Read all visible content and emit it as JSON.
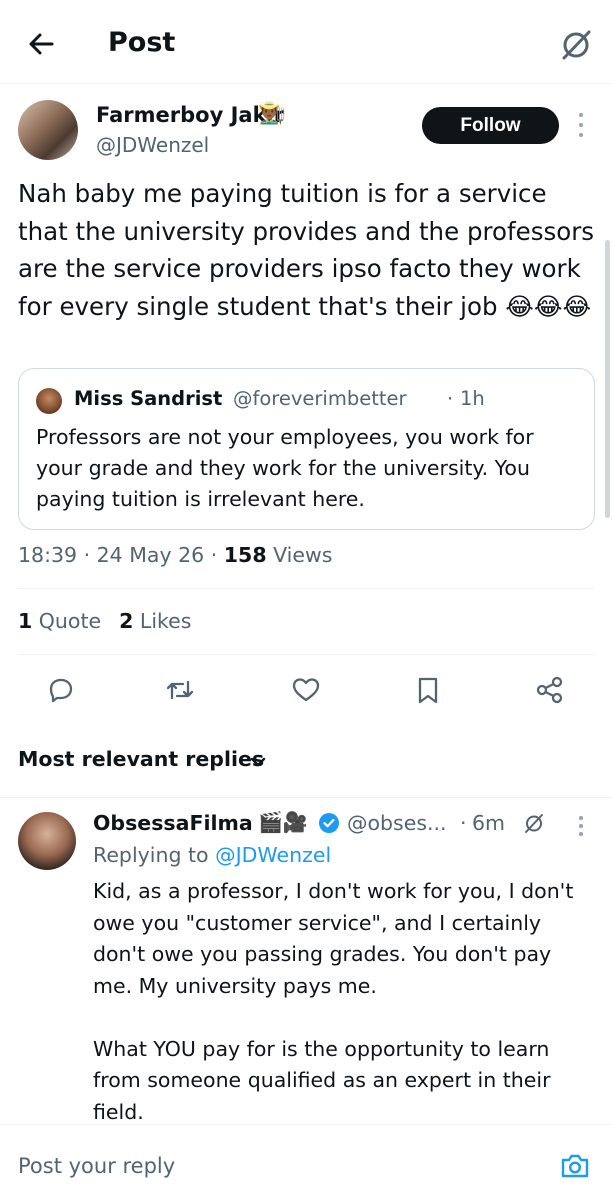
{
  "header": {
    "title": "Post",
    "back_icon": "arrow-left-icon",
    "grok_icon": "grok-slash-circle-icon"
  },
  "post": {
    "author": {
      "name": "Farmerboy Jakir",
      "emoji": "👨🏾‍🌾",
      "handle": "@JDWenzel"
    },
    "follow_label": "Follow",
    "text": "Nah baby me paying tuition is for a service that the university provides and the professors are the service providers ipso facto they work for every single student that's their job 😂😂😂",
    "quote": {
      "name": "Miss Sandrist",
      "handle": "@foreverimbetter",
      "dot": "·",
      "time": "1h",
      "text": "Professors are not your employees, you work for your grade and they work for the university. You paying tuition is irrelevant here."
    },
    "meta": {
      "time": "18:39",
      "sep1": " · ",
      "date": "24 May 26",
      "sep2": " · ",
      "views_count": "158",
      "views_label": " Views"
    },
    "stats": {
      "quotes_count": "1",
      "quotes_label": " Quote",
      "likes_count": "2",
      "likes_label": " Likes"
    },
    "actions": [
      "reply-icon",
      "repost-icon",
      "like-icon",
      "bookmark-icon",
      "share-icon"
    ]
  },
  "replies_sort": {
    "label": "Most relevant replies",
    "icon": "chevron-down-icon"
  },
  "reply": {
    "name": "ObsessaFilma",
    "emoji": "🎬🎥",
    "verified_color": "#1d9bf0",
    "handle": "@obses...",
    "dot": "·",
    "time": "6m",
    "replying_prefix": "Replying to ",
    "replying_handle": "@JDWenzel",
    "paragraphs": [
      "Kid, as a professor, I don't work for you, I don't owe you \"customer service\", and I certainly don't owe you passing grades. You don't pay me. My university pays me.",
      "What YOU pay for is the opportunity to learn from someone qualified as an expert in their field."
    ]
  },
  "compose": {
    "placeholder": "Post your reply",
    "camera_icon": "camera-icon"
  },
  "colors": {
    "accent": "#1d9bf0",
    "text": "#0f1419",
    "muted": "#536471",
    "border": "#cfd9de"
  }
}
